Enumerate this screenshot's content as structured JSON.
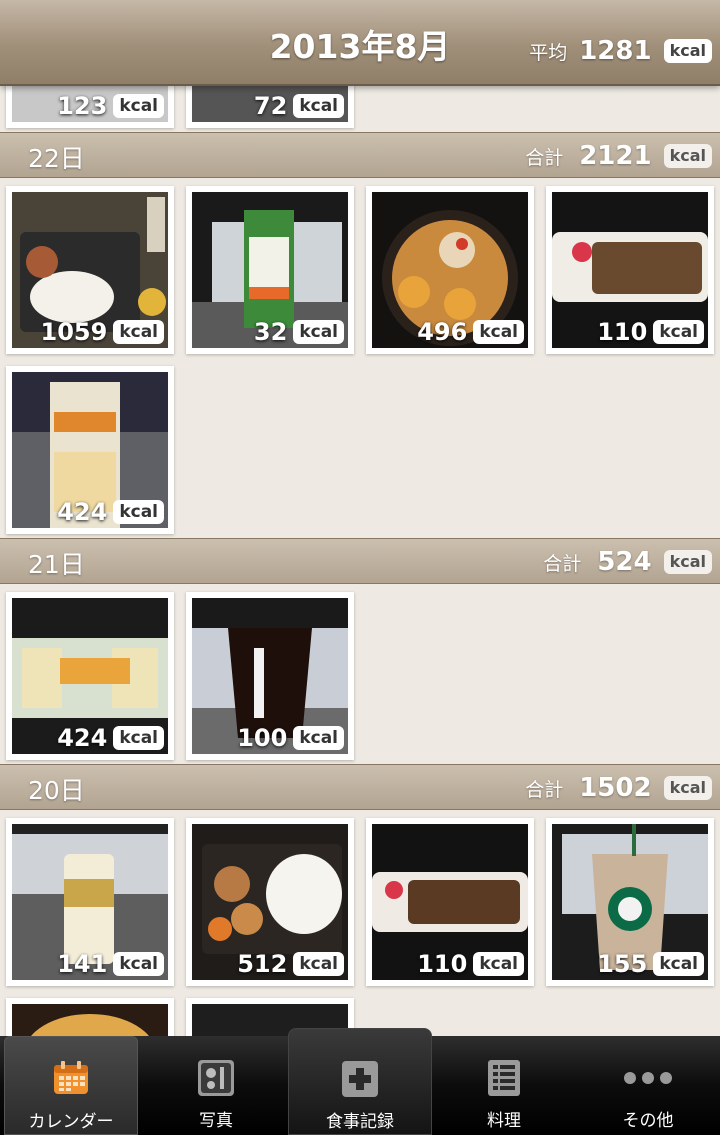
{
  "header": {
    "title": "2013年8月",
    "avg_label": "平均",
    "avg_value": "1281",
    "kcal": "kcal"
  },
  "partial_row": {
    "items": [
      {
        "value": "123",
        "kcal": "kcal"
      },
      {
        "value": "72",
        "kcal": "kcal"
      }
    ]
  },
  "days": [
    {
      "label": "22日",
      "total_label": "合計",
      "total": "2121",
      "kcal": "kcal",
      "items": [
        {
          "value": "1059",
          "kcal": "kcal"
        },
        {
          "value": "32",
          "kcal": "kcal"
        },
        {
          "value": "496",
          "kcal": "kcal"
        },
        {
          "value": "110",
          "kcal": "kcal"
        },
        {
          "value": "424",
          "kcal": "kcal"
        }
      ]
    },
    {
      "label": "21日",
      "total_label": "合計",
      "total": "524",
      "kcal": "kcal",
      "items": [
        {
          "value": "424",
          "kcal": "kcal"
        },
        {
          "value": "100",
          "kcal": "kcal"
        }
      ]
    },
    {
      "label": "20日",
      "total_label": "合計",
      "total": "1502",
      "kcal": "kcal",
      "items": [
        {
          "value": "141",
          "kcal": "kcal"
        },
        {
          "value": "512",
          "kcal": "kcal"
        },
        {
          "value": "110",
          "kcal": "kcal"
        },
        {
          "value": "155",
          "kcal": "kcal"
        }
      ]
    }
  ],
  "tabs": [
    {
      "label": "カレンダー",
      "icon": "calendar-icon"
    },
    {
      "label": "写真",
      "icon": "photo-icon"
    },
    {
      "label": "食事記録",
      "icon": "plus-icon"
    },
    {
      "label": "料理",
      "icon": "menu-list-icon"
    },
    {
      "label": "その他",
      "icon": "more-icon"
    }
  ],
  "colors": {
    "accent": "#e8862e",
    "header": "#a08f79",
    "background": "#eeeae3"
  }
}
